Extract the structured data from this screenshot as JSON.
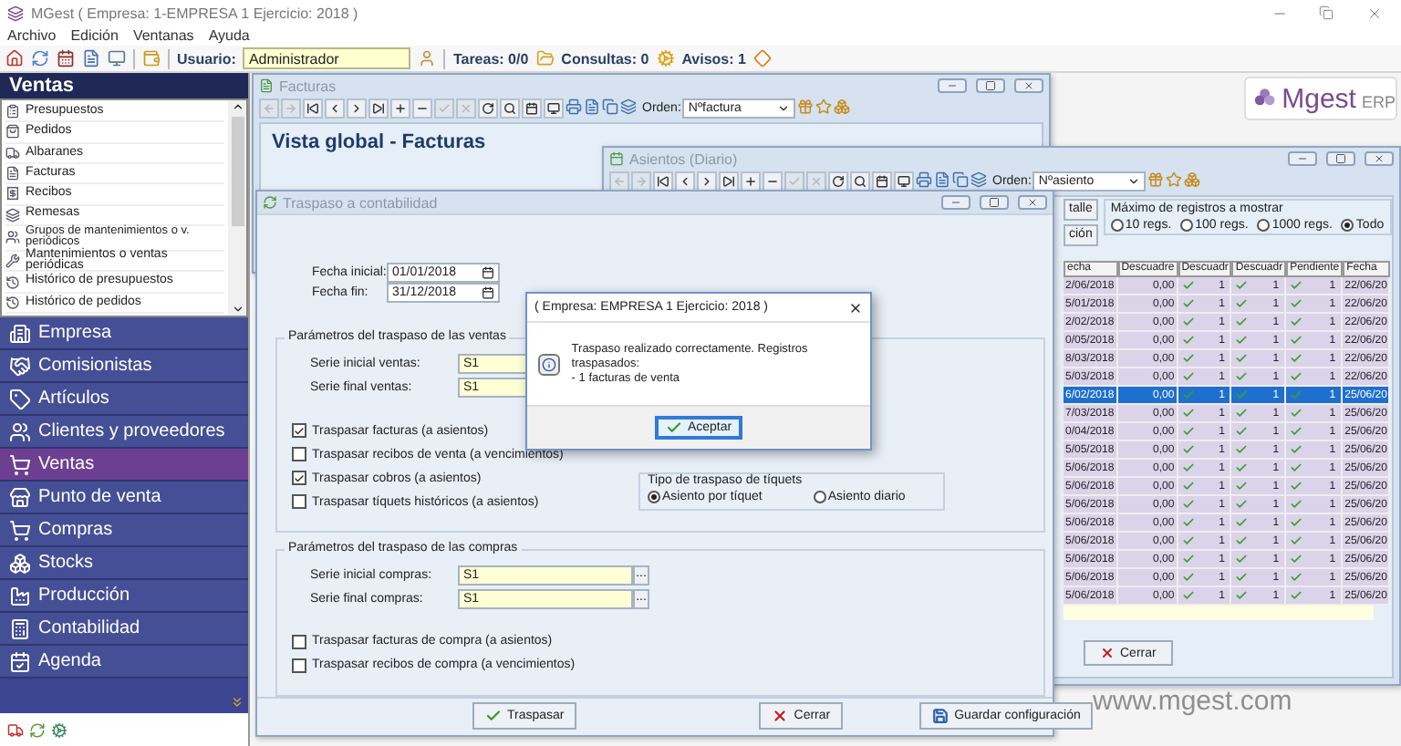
{
  "window": {
    "title": "MGest ( Empresa: 1-EMPRESA 1 Ejercicio: 2018 )"
  },
  "menu": [
    "Archivo",
    "Edición",
    "Ventanas",
    "Ayuda"
  ],
  "toolbar": {
    "user_label": "Usuario:",
    "user": "Administrador",
    "tasks": "Tareas: 0/0",
    "queries": "Consultas: 0",
    "alerts": "Avisos: 1"
  },
  "sidebar": {
    "title": "Ventas",
    "items": [
      "Presupuestos",
      "Pedidos",
      "Albaranes",
      "Facturas",
      "Recibos",
      "Remesas",
      "Grupos de mantenimientos o v. periódicos",
      "Mantenimientos o ventas periódicas",
      "Histórico de presupuestos",
      "Histórico de pedidos"
    ],
    "sections": [
      {
        "label": "Empresa",
        "selected": false
      },
      {
        "label": "Comisionistas",
        "selected": false
      },
      {
        "label": "Artículos",
        "selected": false
      },
      {
        "label": "Clientes y proveedores",
        "selected": false
      },
      {
        "label": "Ventas",
        "selected": true
      },
      {
        "label": "Punto de venta",
        "selected": false
      },
      {
        "label": "Compras",
        "selected": false
      },
      {
        "label": "Stocks",
        "selected": false
      },
      {
        "label": "Producción",
        "selected": false
      },
      {
        "label": "Contabilidad",
        "selected": false
      },
      {
        "label": "Agenda",
        "selected": false
      }
    ]
  },
  "logo": {
    "brand": "Mgest",
    "suffix": "ERP"
  },
  "website": "www.mgest.com",
  "facturas": {
    "title": "Facturas",
    "order_label": "Orden:",
    "order": "Nºfactura",
    "heading": "Vista global  -  Facturas"
  },
  "asientos": {
    "title": "Asientos (Diario)",
    "order_label": "Orden:",
    "order": "Nºasiento",
    "side_buttons": [
      "talle",
      "ción"
    ],
    "max_group": {
      "title": "Máximo de registros a mostrar",
      "options": [
        {
          "label": "10 regs.",
          "selected": false
        },
        {
          "label": "100 regs.",
          "selected": false
        },
        {
          "label": "1000 regs.",
          "selected": false
        },
        {
          "label": "Todo",
          "selected": true
        }
      ]
    },
    "columns": [
      "echa",
      "Descuadre",
      "Descuadr",
      "Descuadr",
      "Pendiente",
      "Fecha"
    ],
    "rows": [
      {
        "date": "2/06/2018",
        "amount": "0,00",
        "flags": [
          {
            "checked": true,
            "value": "1"
          },
          {
            "checked": true,
            "value": "1"
          },
          {
            "checked": true,
            "value": "1"
          }
        ],
        "date2": "22/06/20",
        "selected": false
      },
      {
        "date": "5/01/2018",
        "amount": "0,00",
        "flags": [
          {
            "checked": true,
            "value": "1"
          },
          {
            "checked": true,
            "value": "1"
          },
          {
            "checked": true,
            "value": "1"
          }
        ],
        "date2": "22/06/20",
        "selected": false
      },
      {
        "date": "2/02/2018",
        "amount": "0,00",
        "flags": [
          {
            "checked": true,
            "value": "1"
          },
          {
            "checked": true,
            "value": "1"
          },
          {
            "checked": true,
            "value": "1"
          }
        ],
        "date2": "22/06/20",
        "selected": false
      },
      {
        "date": "0/05/2018",
        "amount": "0,00",
        "flags": [
          {
            "checked": true,
            "value": "1"
          },
          {
            "checked": true,
            "value": "1"
          },
          {
            "checked": true,
            "value": "1"
          }
        ],
        "date2": "22/06/20",
        "selected": false
      },
      {
        "date": "8/03/2018",
        "amount": "0,00",
        "flags": [
          {
            "checked": true,
            "value": "1"
          },
          {
            "checked": true,
            "value": "1"
          },
          {
            "checked": true,
            "value": "1"
          }
        ],
        "date2": "22/06/20",
        "selected": false
      },
      {
        "date": "5/03/2018",
        "amount": "0,00",
        "flags": [
          {
            "checked": true,
            "value": "1"
          },
          {
            "checked": true,
            "value": "1"
          },
          {
            "checked": true,
            "value": "1"
          }
        ],
        "date2": "22/06/20",
        "selected": false
      },
      {
        "date": "6/02/2018",
        "amount": "0,00",
        "flags": [
          {
            "checked": true,
            "value": "1"
          },
          {
            "checked": true,
            "value": "1"
          },
          {
            "checked": true,
            "value": "1"
          }
        ],
        "date2": "25/06/20",
        "selected": true
      },
      {
        "date": "7/03/2018",
        "amount": "0,00",
        "flags": [
          {
            "checked": true,
            "value": "1"
          },
          {
            "checked": true,
            "value": "1"
          },
          {
            "checked": true,
            "value": "1"
          }
        ],
        "date2": "25/06/20",
        "selected": false
      },
      {
        "date": "0/04/2018",
        "amount": "0,00",
        "flags": [
          {
            "checked": true,
            "value": "1"
          },
          {
            "checked": true,
            "value": "1"
          },
          {
            "checked": true,
            "value": "1"
          }
        ],
        "date2": "25/06/20",
        "selected": false
      },
      {
        "date": "5/05/2018",
        "amount": "0,00",
        "flags": [
          {
            "checked": true,
            "value": "1"
          },
          {
            "checked": true,
            "value": "1"
          },
          {
            "checked": true,
            "value": "1"
          }
        ],
        "date2": "25/06/20",
        "selected": false
      },
      {
        "date": "5/06/2018",
        "amount": "0,00",
        "flags": [
          {
            "checked": true,
            "value": "1"
          },
          {
            "checked": true,
            "value": "1"
          },
          {
            "checked": true,
            "value": "1"
          }
        ],
        "date2": "25/06/20",
        "selected": false
      },
      {
        "date": "5/06/2018",
        "amount": "0,00",
        "flags": [
          {
            "checked": true,
            "value": "1"
          },
          {
            "checked": true,
            "value": "1"
          },
          {
            "checked": true,
            "value": "1"
          }
        ],
        "date2": "25/06/20",
        "selected": false
      },
      {
        "date": "5/06/2018",
        "amount": "0,00",
        "flags": [
          {
            "checked": true,
            "value": "1"
          },
          {
            "checked": true,
            "value": "1"
          },
          {
            "checked": true,
            "value": "1"
          }
        ],
        "date2": "25/06/20",
        "selected": false
      },
      {
        "date": "5/06/2018",
        "amount": "0,00",
        "flags": [
          {
            "checked": true,
            "value": "1"
          },
          {
            "checked": true,
            "value": "1"
          },
          {
            "checked": true,
            "value": "1"
          }
        ],
        "date2": "25/06/20",
        "selected": false
      },
      {
        "date": "5/06/2018",
        "amount": "0,00",
        "flags": [
          {
            "checked": true,
            "value": "1"
          },
          {
            "checked": true,
            "value": "1"
          },
          {
            "checked": true,
            "value": "1"
          }
        ],
        "date2": "25/06/20",
        "selected": false
      },
      {
        "date": "5/06/2018",
        "amount": "0,00",
        "flags": [
          {
            "checked": true,
            "value": "1"
          },
          {
            "checked": true,
            "value": "1"
          },
          {
            "checked": true,
            "value": "1"
          }
        ],
        "date2": "25/06/20",
        "selected": false
      },
      {
        "date": "5/06/2018",
        "amount": "0,00",
        "flags": [
          {
            "checked": true,
            "value": "1"
          },
          {
            "checked": true,
            "value": "1"
          },
          {
            "checked": true,
            "value": "1"
          }
        ],
        "date2": "25/06/20",
        "selected": false
      },
      {
        "date": "5/06/2018",
        "amount": "0,00",
        "flags": [
          {
            "checked": true,
            "value": "1"
          },
          {
            "checked": true,
            "value": "1"
          },
          {
            "checked": true,
            "value": "1"
          }
        ],
        "date2": "25/06/20",
        "selected": false
      }
    ],
    "close": "Cerrar"
  },
  "traspaso": {
    "title": "Traspaso a contabilidad",
    "dates": [
      {
        "label": "Fecha inicial:",
        "value": "01/01/2018"
      },
      {
        "label": "Fecha fin:",
        "value": "31/12/2018"
      }
    ],
    "sales": {
      "title": "Parámetros del traspaso de las ventas",
      "series": [
        {
          "label": "Serie inicial ventas:",
          "value": "S1"
        },
        {
          "label": "Serie final ventas:",
          "value": "S1"
        }
      ],
      "options": [
        {
          "label": "Traspasar facturas (a asientos)",
          "checked": true
        },
        {
          "label": "Traspasar recibos de venta (a vencimientos)",
          "checked": false
        },
        {
          "label": "Traspasar cobros (a asientos)",
          "checked": true
        },
        {
          "label": "Traspasar tíquets históricos (a asientos)",
          "checked": false
        }
      ],
      "ticket_type": {
        "title": "Tipo de traspaso de tíquets",
        "options": [
          {
            "label": "Asiento por tíquet",
            "selected": true
          },
          {
            "label": "Asiento diario",
            "selected": false
          }
        ]
      }
    },
    "purchases": {
      "title": "Parámetros del traspaso de las compras",
      "series": [
        {
          "label": "Serie inicial compras:",
          "value": "S1",
          "browse": "..."
        },
        {
          "label": "Serie final compras:",
          "value": "S1",
          "browse": "..."
        }
      ],
      "options": [
        {
          "label": "Traspasar facturas de compra (a asientos)",
          "checked": false
        },
        {
          "label": "Traspasar recibos de compra (a vencimientos)",
          "checked": false
        }
      ]
    },
    "buttons": [
      {
        "label": "Traspasar",
        "kind": "ok"
      },
      {
        "label": "Cerrar",
        "kind": "cancel"
      },
      {
        "label": "Guardar configuración",
        "kind": "save"
      }
    ]
  },
  "dialog": {
    "title": "( Empresa: EMPRESA 1 Ejercicio: 2018 )",
    "message": "Traspaso realizado correctamente. Registros traspasados:\n- 1 facturas de venta",
    "button": "Aceptar"
  }
}
